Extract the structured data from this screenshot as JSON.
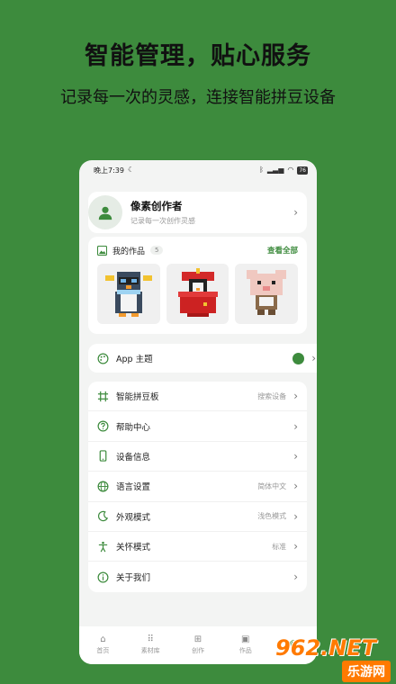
{
  "promo": {
    "headline": "智能管理，贴心服务",
    "subline": "记录每一次的灵感，连接智能拼豆设备"
  },
  "statusbar": {
    "time": "晚上7:39",
    "battery": "76"
  },
  "profile": {
    "name": "像素创作者",
    "subtitle": "记录每一次创作灵感"
  },
  "works": {
    "title": "我的作品",
    "count": "5",
    "view_all": "查看全部"
  },
  "theme": {
    "label": "App 主题",
    "accent": "#3d8b3d"
  },
  "settings": [
    {
      "label": "智能拼豆板",
      "value": "搜索设备"
    },
    {
      "label": "帮助中心",
      "value": ""
    },
    {
      "label": "设备信息",
      "value": ""
    },
    {
      "label": "语言设置",
      "value": "简体中文"
    },
    {
      "label": "外观模式",
      "value": "浅色模式"
    },
    {
      "label": "关怀模式",
      "value": "标准"
    },
    {
      "label": "关于我们",
      "value": ""
    }
  ],
  "tabs": [
    {
      "label": "首页",
      "icon": "home-icon"
    },
    {
      "label": "素材库",
      "icon": "grid-icon"
    },
    {
      "label": "创作",
      "icon": "plus-square-icon"
    },
    {
      "label": "作品",
      "icon": "images-icon"
    },
    {
      "label": "",
      "icon": "paw-icon"
    }
  ],
  "watermark": {
    "top": "962.NET",
    "bottom": "乐游网"
  }
}
